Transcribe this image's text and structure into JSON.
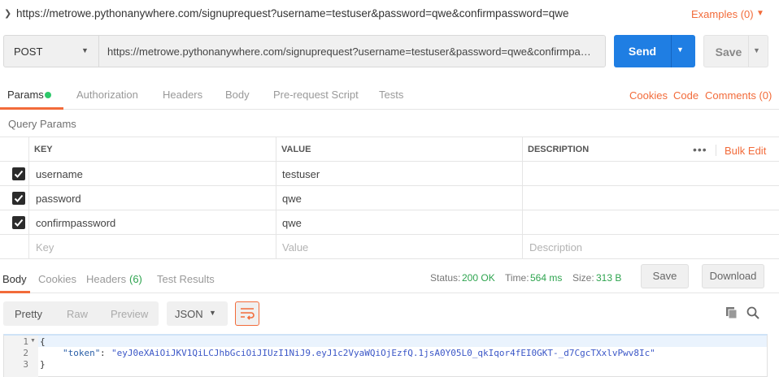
{
  "title": {
    "url": "https://metrowe.pythonanywhere.com/signuprequest?username=testuser&password=qwe&confirmpassword=qwe",
    "examples": "Examples (0)"
  },
  "request": {
    "method": "POST",
    "url": "https://metrowe.pythonanywhere.com/signuprequest?username=testuser&password=qwe&confirmpassword=qwe",
    "send_label": "Send",
    "save_label": "Save"
  },
  "tabs": {
    "items": [
      "Params",
      "Authorization",
      "Headers",
      "Body",
      "Pre-request Script",
      "Tests"
    ],
    "active": "Params",
    "right_links": [
      "Cookies",
      "Code",
      "Comments (0)"
    ]
  },
  "query_params": {
    "label": "Query Params",
    "headers": [
      "KEY",
      "VALUE",
      "DESCRIPTION"
    ],
    "bulk_edit": "Bulk Edit",
    "rows": [
      {
        "checked": true,
        "key": "username",
        "value": "testuser",
        "description": ""
      },
      {
        "checked": true,
        "key": "password",
        "value": "qwe",
        "description": ""
      },
      {
        "checked": true,
        "key": "confirmpassword",
        "value": "qwe",
        "description": ""
      }
    ],
    "placeholder": {
      "key": "Key",
      "value": "Value",
      "description": "Description"
    }
  },
  "response": {
    "tabs": [
      "Body",
      "Cookies",
      "Headers",
      "Test Results"
    ],
    "headers_count": "(6)",
    "status_label": "Status:",
    "status_value": "200 OK",
    "time_label": "Time:",
    "time_value": "564 ms",
    "size_label": "Size:",
    "size_value": "313 B",
    "save_label": "Save",
    "download_label": "Download",
    "view_modes": [
      "Pretty",
      "Raw",
      "Preview"
    ],
    "active_view": "Pretty",
    "format": "JSON",
    "code_lines": [
      "1",
      "2",
      "3"
    ],
    "json_key": "\"token\"",
    "json_value": "\"eyJ0eXAiOiJKV1QiLCJhbGciOiJIUzI1NiJ9.eyJ1c2VyaWQiOjEzfQ.1jsA0Y05L0_qkIqor4fEI0GKT-_d7CgcTXxlvPwv8Ic\""
  },
  "colors": {
    "accent": "#f26b3a",
    "send": "#1f7ee3",
    "status_ok": "#2ea44f",
    "active_dot": "#2ec86b"
  },
  "icons": [
    "chevron-right-icon",
    "caret-down-icon",
    "checkbox-checked-icon",
    "more-dots-icon",
    "wrap-lines-icon",
    "copy-icon",
    "search-icon"
  ]
}
